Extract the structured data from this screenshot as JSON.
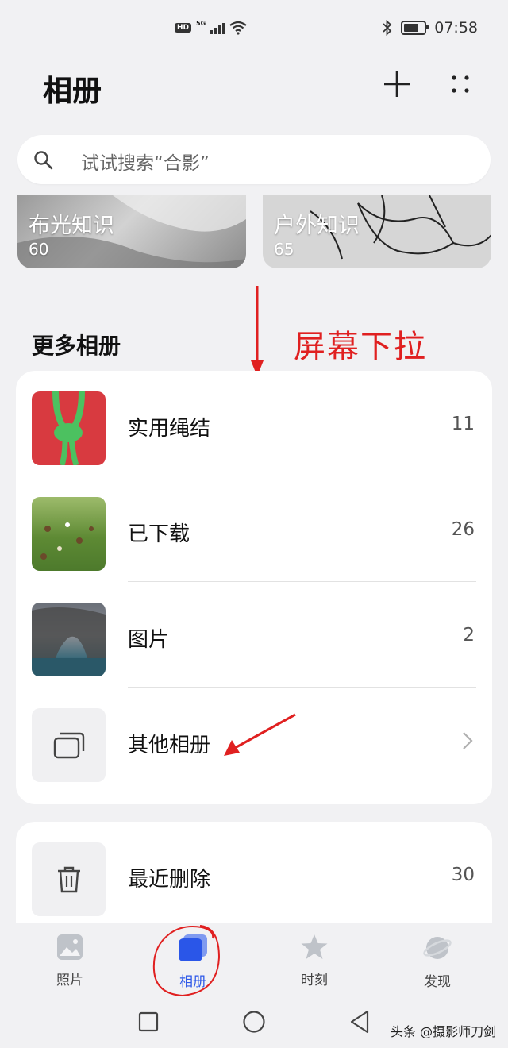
{
  "status_bar": {
    "hd": "HD",
    "network": "5G",
    "time": "07:58"
  },
  "header": {
    "title": "相册",
    "add_icon": "plus-icon",
    "more_icon": "more-dots-icon"
  },
  "search": {
    "placeholder": "试试搜索“合影”",
    "icon": "search-icon"
  },
  "top_albums": [
    {
      "name": "布光知识",
      "count": "60"
    },
    {
      "name": "户外知识",
      "count": "65"
    }
  ],
  "section": {
    "title": "更多相册"
  },
  "annotation": {
    "text": "屏幕下拉",
    "color": "#e02020"
  },
  "albums": [
    {
      "name": "实用绳结",
      "count": "11"
    },
    {
      "name": "已下载",
      "count": "26"
    },
    {
      "name": "图片",
      "count": "2"
    },
    {
      "name": "其他相册",
      "count": ""
    }
  ],
  "trash": {
    "name": "最近删除",
    "count": "30"
  },
  "tabs": [
    {
      "label": "照片",
      "icon": "photo-icon",
      "active": false
    },
    {
      "label": "相册",
      "icon": "album-icon",
      "active": true
    },
    {
      "label": "时刻",
      "icon": "star-icon",
      "active": false
    },
    {
      "label": "发现",
      "icon": "planet-icon",
      "active": false
    }
  ],
  "watermark": "头条 @摄影师刀剑",
  "colors": {
    "accent": "#2a56e8",
    "background": "#f1f1f3",
    "annotation": "#e02020"
  }
}
